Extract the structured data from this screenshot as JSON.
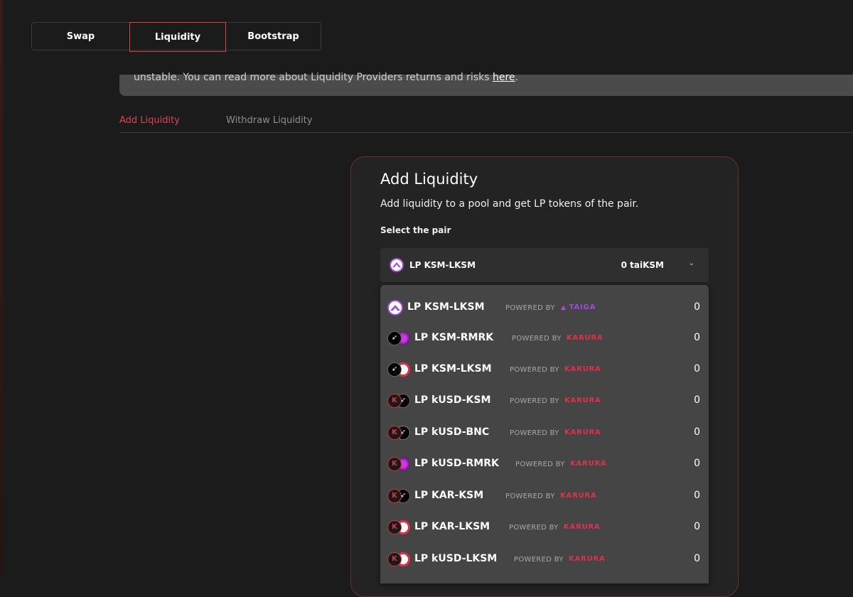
{
  "nav": {
    "tabs": [
      {
        "label": "Swap"
      },
      {
        "label": "Liquidity",
        "active": true
      },
      {
        "label": "Bootstrap"
      }
    ]
  },
  "banner": {
    "text": "unstable. You can read more about Liquidity Providers returns and risks ",
    "link_text": "here",
    "trailing": "."
  },
  "subtabs": {
    "add": "Add Liquidity",
    "withdraw": "Withdraw Liquidity"
  },
  "card": {
    "title": "Add Liquidity",
    "subtitle": "Add liquidity to a pool and get LP tokens of the pair.",
    "select_label": "Select the pair",
    "selected": {
      "name": "LP KSM-LKSM",
      "balance": "0 taiKSM",
      "chevron": "⌄"
    }
  },
  "dropdown": {
    "powered_by": "POWERED BY",
    "options": [
      {
        "name": "LP KSM-LKSM",
        "brand": "TAIGA",
        "value": "0"
      },
      {
        "name": "LP KSM-RMRK",
        "brand": "KARURA",
        "value": "0"
      },
      {
        "name": "LP KSM-LKSM",
        "brand": "KARURA",
        "value": "0"
      },
      {
        "name": "LP kUSD-KSM",
        "brand": "KARURA",
        "value": "0"
      },
      {
        "name": "LP kUSD-BNC",
        "brand": "KARURA",
        "value": "0"
      },
      {
        "name": "LP kUSD-RMRK",
        "brand": "KARURA",
        "value": "0"
      },
      {
        "name": "LP KAR-KSM",
        "brand": "KARURA",
        "value": "0"
      },
      {
        "name": "LP KAR-LKSM",
        "brand": "KARURA",
        "value": "0"
      },
      {
        "name": "LP kUSD-LKSM",
        "brand": "KARURA",
        "value": "0"
      }
    ]
  },
  "colors": {
    "accent": "#e0405a",
    "taiga": "#a24adf",
    "karura": "#e0304a"
  }
}
